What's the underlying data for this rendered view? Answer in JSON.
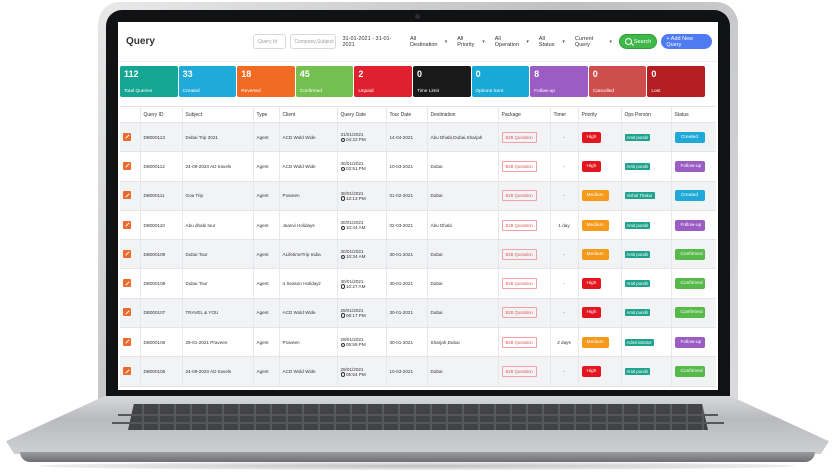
{
  "header": {
    "title": "Query",
    "query_id_placeholder": "Query Id",
    "company_subject_placeholder": "Company,Subject",
    "date_range": "31-01-2021 - 31-01-2021",
    "filters": [
      "All Destination",
      "All Priority",
      "All Operation",
      "All Status",
      "Current Query"
    ],
    "search_label": "Search",
    "add_label": "+ Add New Query"
  },
  "tiles": [
    {
      "count": "112",
      "label": "Total Queries",
      "color": "#14a593"
    },
    {
      "count": "33",
      "label": "Created",
      "color": "#1faad9"
    },
    {
      "count": "18",
      "label": "Reverted",
      "color": "#f26b22"
    },
    {
      "count": "45",
      "label": "Confirmed",
      "color": "#73c050"
    },
    {
      "count": "2",
      "label": "Unpaid",
      "color": "#e0202e"
    },
    {
      "count": "0",
      "label": "Time Limit",
      "color": "#1a1a1a"
    },
    {
      "count": "0",
      "label": "Options Sent",
      "color": "#18a9d6"
    },
    {
      "count": "8",
      "label": "Follow-up",
      "color": "#9b5cc4"
    },
    {
      "count": "0",
      "label": "Cancelled",
      "color": "#ce4d4d"
    },
    {
      "count": "0",
      "label": "Lost",
      "color": "#b31e23"
    }
  ],
  "columns": [
    "",
    "Query ID",
    "Subject",
    "Type",
    "Client",
    "Query Date",
    "Tour Date",
    "Destination",
    "Package",
    "Timer",
    "Priority",
    "Ops Person",
    "Status"
  ],
  "rows": [
    {
      "id": "DB000113",
      "subject": "Dubai Trip 2021",
      "type": "Agent",
      "client": "ACD Wold Wide",
      "qdate": "31/01/2021",
      "qtime": "04:22 PM",
      "tour": "14-04-2021",
      "dest": "Abu Dhabi,Dubai,Sharjah",
      "pkg": "B2B Quotation",
      "timer": "-",
      "priority": "High",
      "ops": "Amit pundir",
      "status": "Created"
    },
    {
      "id": "DB000112",
      "subject": "24-09-2020 AD travels",
      "type": "Agent",
      "client": "ACD Wold Wide",
      "qdate": "30/01/2021",
      "qtime": "02:51 PM",
      "tour": "10-03-2021",
      "dest": "Dubai",
      "pkg": "B2B Quotation",
      "timer": "-",
      "priority": "High",
      "ops": "Amit pundir",
      "status": "Follow-up"
    },
    {
      "id": "DB000111",
      "subject": "Goa Trip",
      "type": "Agent",
      "client": "Praveen",
      "qdate": "30/01/2021",
      "qtime": "12:13 PM",
      "tour": "01-02-2021",
      "dest": "Dubai",
      "pkg": "B2B Quotation",
      "timer": "-",
      "priority": "Medium",
      "ops": "Vishal Thakur",
      "status": "Created"
    },
    {
      "id": "DB000110",
      "subject": "Abu dhabi tour",
      "type": "Agent",
      "client": "Jaanvi Holidays",
      "qdate": "30/01/2021",
      "qtime": "10:44 AM",
      "tour": "02-03-2021",
      "dest": "Abu Dhabi",
      "pkg": "B2B Quotation",
      "timer": "1 day",
      "priority": "Medium",
      "ops": "Amit pundir",
      "status": "Follow-up"
    },
    {
      "id": "DB000109",
      "subject": "Dubai Tour",
      "type": "Agent",
      "client": "ALifetimeTrip India",
      "qdate": "30/01/2021",
      "qtime": "10:34 AM",
      "tour": "30-01-2021",
      "dest": "Dubai",
      "pkg": "B2B Quotation",
      "timer": "-",
      "priority": "Medium",
      "ops": "Amit pundir",
      "status": "Confirmed"
    },
    {
      "id": "DB000108",
      "subject": "Dubai Tour",
      "type": "Agent",
      "client": "4 Season Holidayz",
      "qdate": "30/01/2021",
      "qtime": "10:27 AM",
      "tour": "30-01-2021",
      "dest": "Dubai",
      "pkg": "B2B Quotation",
      "timer": "-",
      "priority": "High",
      "ops": "Amit pundir",
      "status": "Confirmed"
    },
    {
      "id": "DB000107",
      "subject": "TRAVEL & YOU",
      "type": "Agent",
      "client": "ACD Wold Wide",
      "qdate": "29/01/2021",
      "qtime": "06:17 PM",
      "tour": "30-01-2021",
      "dest": "Dubai",
      "pkg": "B2B Quotation",
      "timer": "-",
      "priority": "High",
      "ops": "Amit pundir",
      "status": "Confirmed"
    },
    {
      "id": "DB000106",
      "subject": "29-01-2021 Praveen",
      "type": "Agent",
      "client": "Praveen",
      "qdate": "29/01/2021",
      "qtime": "05:59 PM",
      "tour": "30-01-2021",
      "dest": "Sharjah,Dubai",
      "pkg": "B2B Quotation",
      "timer": "2 days",
      "priority": "Medium",
      "ops": "Administrator",
      "status": "Follow-up"
    },
    {
      "id": "DB000105",
      "subject": "24-09-2020 AD travels",
      "type": "Agent",
      "client": "ACD Wold Wide",
      "qdate": "29/01/2021",
      "qtime": "05:54 PM",
      "tour": "10-03-2021",
      "dest": "Dubai",
      "pkg": "B2B Quotation",
      "timer": "-",
      "priority": "High",
      "ops": "Amit pundir",
      "status": "Confirmed"
    }
  ],
  "priority_colors": {
    "High": "#e3161f",
    "Medium": "#f79a1c"
  },
  "status_colors": {
    "Created": "#1fa9d8",
    "Follow-up": "#9b5cc4",
    "Confirmed": "#56b94a"
  }
}
